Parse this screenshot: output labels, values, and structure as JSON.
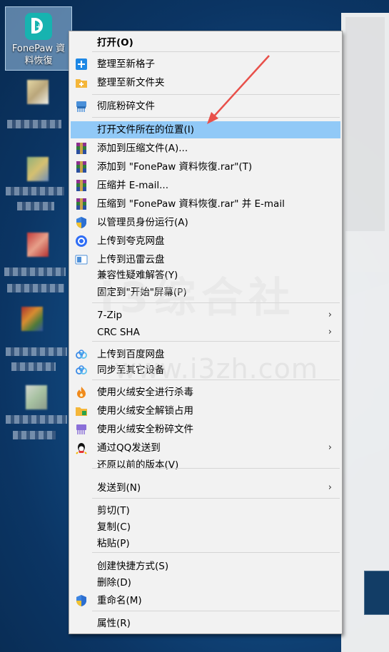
{
  "desktop": {
    "selected_icon_label_line1": "FonePaw 資",
    "selected_icon_label_line2": "料恢復",
    "watermark": "i3综合社",
    "watermark_url": "www.i3zh.com"
  },
  "menu": {
    "items": [
      {
        "label": "打开(O)",
        "icon": "none",
        "bold": true
      },
      {
        "label": "整理至新格子",
        "icon": "plus-blue-icon"
      },
      {
        "label": "整理至新文件夹",
        "icon": "plus-folder-icon"
      },
      {
        "label": "彻底粉碎文件",
        "icon": "shredder-icon"
      },
      {
        "label": "打开文件所在的位置(I)",
        "icon": "none",
        "highlighted": true
      },
      {
        "label": "添加到压缩文件(A)...",
        "icon": "winrar-icon"
      },
      {
        "label": "添加到 \"FonePaw 資料恢復.rar\"(T)",
        "icon": "winrar-icon"
      },
      {
        "label": "压缩并 E-mail...",
        "icon": "winrar-icon"
      },
      {
        "label": "压缩到 \"FonePaw 資料恢復.rar\" 并 E-mail",
        "icon": "winrar-icon"
      },
      {
        "label": "以管理员身份运行(A)",
        "icon": "uac-shield-icon"
      },
      {
        "label": "上传到夸克网盘",
        "icon": "quark-icon"
      },
      {
        "label": "上传到迅雷云盘",
        "icon": "xunlei-icon"
      },
      {
        "label": "兼容性疑难解答(Y)",
        "icon": "none"
      },
      {
        "label": "固定到\"开始\"屏幕(P)",
        "icon": "none"
      },
      {
        "label": "7-Zip",
        "icon": "none",
        "submenu": true
      },
      {
        "label": "CRC SHA",
        "icon": "none",
        "submenu": true
      },
      {
        "label": "上传到百度网盘",
        "icon": "baidu-cloud-icon"
      },
      {
        "label": "同步至其它设备",
        "icon": "baidu-cloud-icon"
      },
      {
        "label": "使用火绒安全进行杀毒",
        "icon": "huorong-icon"
      },
      {
        "label": "使用火绒安全解锁占用",
        "icon": "huorong-unlock-icon"
      },
      {
        "label": "使用火绒安全粉碎文件",
        "icon": "huorong-shred-icon"
      },
      {
        "label": "通过QQ发送到",
        "icon": "qq-icon",
        "submenu": true
      },
      {
        "label": "还原以前的版本(V)",
        "icon": "none"
      },
      {
        "label": "发送到(N)",
        "icon": "none",
        "submenu": true
      },
      {
        "label": "剪切(T)",
        "icon": "none"
      },
      {
        "label": "复制(C)",
        "icon": "none"
      },
      {
        "label": "粘贴(P)",
        "icon": "none"
      },
      {
        "label": "创建快捷方式(S)",
        "icon": "none"
      },
      {
        "label": "删除(D)",
        "icon": "none"
      },
      {
        "label": "重命名(M)",
        "icon": "uac-shield-icon"
      },
      {
        "label": "属性(R)",
        "icon": "none"
      }
    ],
    "submenu_arrow": "›"
  },
  "colors": {
    "highlight": "#91c9f7",
    "annotation_arrow": "#e8504a"
  }
}
